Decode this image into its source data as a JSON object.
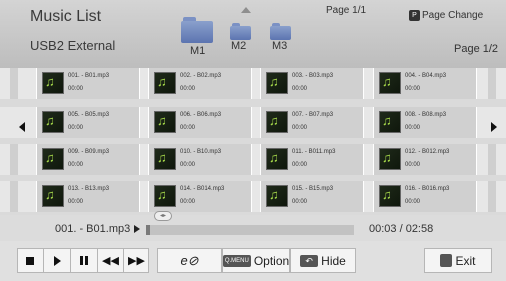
{
  "header": {
    "title": "Music List",
    "device": "USB2 External",
    "page_info": "Page 1/1",
    "page_change_key": "P",
    "page_change_label": "Page Change",
    "sub_page": "Page 1/2"
  },
  "folders": [
    {
      "label": "M1"
    },
    {
      "label": "M2"
    },
    {
      "label": "M3"
    }
  ],
  "tracks": [
    {
      "name": "001. - B01.mp3",
      "time": "00:00"
    },
    {
      "name": "002. - B02.mp3",
      "time": "00:00"
    },
    {
      "name": "003. - B03.mp3",
      "time": "00:00"
    },
    {
      "name": "004. - B04.mp3",
      "time": "00:00"
    },
    {
      "name": "005. - B05.mp3",
      "time": "00:00"
    },
    {
      "name": "006. - B06.mp3",
      "time": "00:00"
    },
    {
      "name": "007. - B07.mp3",
      "time": "00:00"
    },
    {
      "name": "008. - B08.mp3",
      "time": "00:00"
    },
    {
      "name": "009. - B09.mp3",
      "time": "00:00"
    },
    {
      "name": "010. - B10.mp3",
      "time": "00:00"
    },
    {
      "name": "011. - B011.mp3",
      "time": "00:00"
    },
    {
      "name": "012. - B012.mp3",
      "time": "00:00"
    },
    {
      "name": "013. - B13.mp3",
      "time": "00:00"
    },
    {
      "name": "014. - B014.mp3",
      "time": "00:00"
    },
    {
      "name": "015. - B15.mp3",
      "time": "00:00"
    },
    {
      "name": "016. - B016.mp3",
      "time": "00:00"
    }
  ],
  "now_playing": {
    "title": "001. - B01.mp3",
    "time": "00:03 / 02:58",
    "progress_fraction": 0.017
  },
  "controls": {
    "option_key": "Q.MENU",
    "option_label": "Option",
    "hide_label": "Hide",
    "exit_label": "Exit"
  },
  "colors": {
    "header_bg": "#c6c6c6",
    "tile_bg": "#d0d0d0",
    "folder_blue": "#6a82bc",
    "note_green": "#a6d94a"
  }
}
